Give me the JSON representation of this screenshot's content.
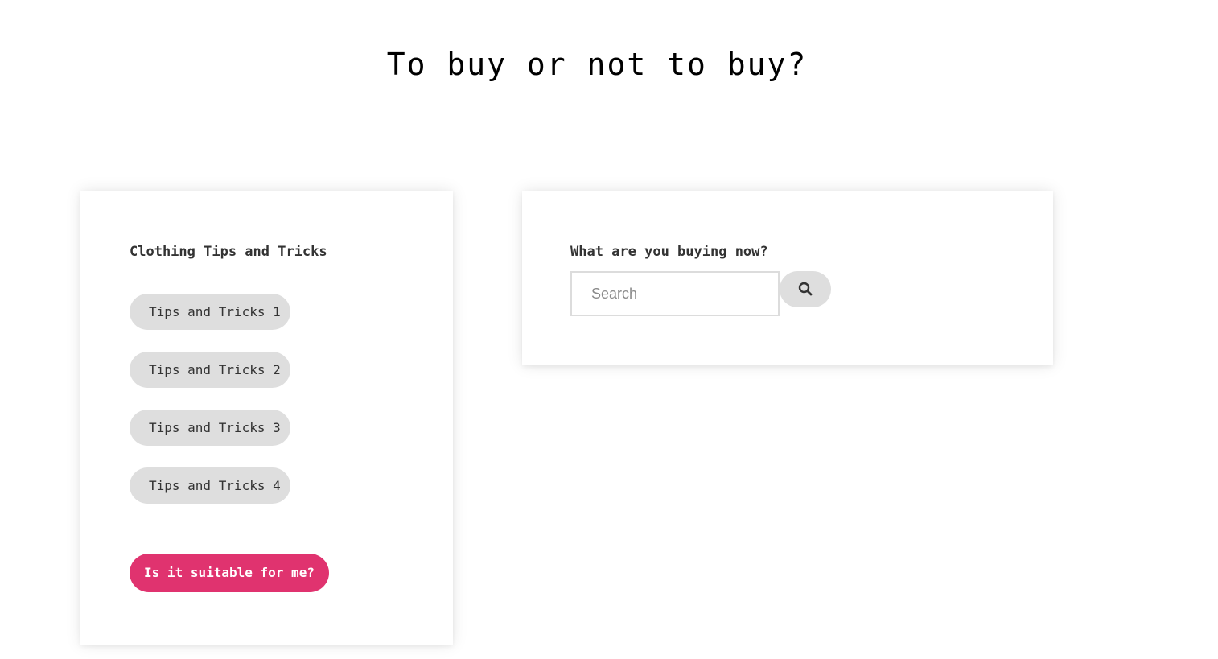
{
  "page": {
    "title": "To buy or not to buy?"
  },
  "tips_card": {
    "heading": "Clothing Tips and Tricks",
    "items": [
      {
        "label": "Tips and Tricks 1"
      },
      {
        "label": "Tips and Tricks 2"
      },
      {
        "label": "Tips and Tricks 3"
      },
      {
        "label": "Tips and Tricks 4"
      }
    ],
    "cta_label": "Is it suitable for me?"
  },
  "search_card": {
    "heading": "What are you buying now?",
    "search": {
      "placeholder": "Search",
      "value": "",
      "button_icon": "search-icon"
    }
  },
  "colors": {
    "accent": "#e0336f",
    "pill_background": "#dedede",
    "page_background": "#ffffff"
  }
}
